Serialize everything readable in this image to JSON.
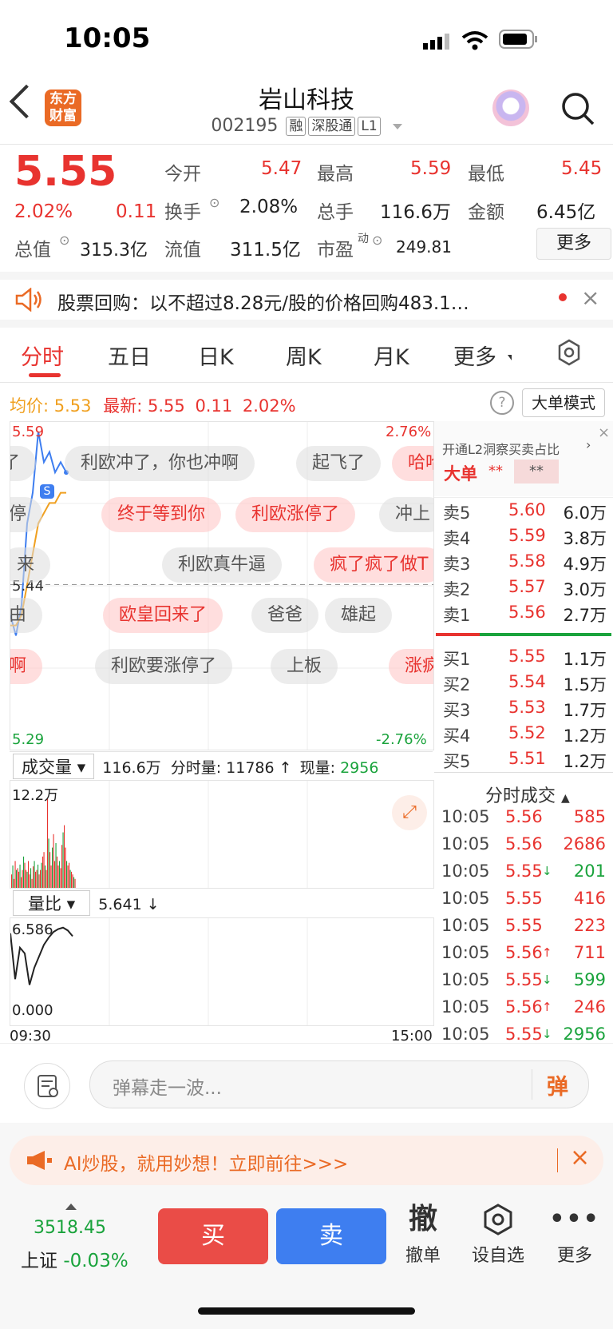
{
  "status_bar": {
    "time": "10:05"
  },
  "header": {
    "logo_text": "东方财富",
    "title": "岩山科技",
    "code": "002195",
    "tags": [
      "融",
      "深股通",
      "L1"
    ]
  },
  "quote": {
    "price": "5.55",
    "change_pct": "2.02%",
    "change": "0.11",
    "open_label": "今开",
    "open": "5.47",
    "high_label": "最高",
    "high": "5.59",
    "low_label": "最低",
    "low": "5.45",
    "turnover_label": "换手",
    "turnover": "2.08%",
    "volume_label": "总手",
    "volume": "116.6万",
    "amount_label": "金额",
    "amount": "6.45亿",
    "mktcap_label": "总值",
    "mktcap": "315.3亿",
    "float_label": "流值",
    "float": "311.5亿",
    "pe_label": "市盈",
    "pe_sup": "动",
    "pe": "249.81",
    "more_button": "更多"
  },
  "notice": {
    "text": "股票回购：以不超过8.28元/股的价格回购483.1…"
  },
  "tabs": [
    "分时",
    "五日",
    "日K",
    "周K",
    "月K",
    "更多"
  ],
  "info_line": {
    "avg_label": "均价:",
    "avg": "5.53",
    "latest_label": "最新:",
    "latest": "5.55",
    "latest_change": "0.11",
    "latest_pct": "2.02%",
    "mode_button": "大单模式"
  },
  "chart_data": {
    "type": "line",
    "ylabels_left": [
      "5.59",
      "5.44",
      "5.29"
    ],
    "ylabels_right": [
      "2.76%",
      "-2.76%"
    ],
    "xlabels": [
      "09:30",
      "15:00"
    ],
    "price_ref": 5.44,
    "series": [
      {
        "name": "最新",
        "color": "#3e7ef0",
        "values": [
          5.41,
          5.39,
          5.42,
          5.5,
          5.53,
          5.59,
          5.56,
          5.57,
          5.55,
          5.56,
          5.55
        ]
      },
      {
        "name": "均价",
        "color": "#f0a020",
        "values": [
          5.4,
          5.4,
          5.41,
          5.44,
          5.47,
          5.5,
          5.51,
          5.52,
          5.52,
          5.53,
          5.53
        ]
      }
    ]
  },
  "danmu": [
    {
      "text": "了",
      "style": "g"
    },
    {
      "text": "利欧冲了，你也冲啊",
      "style": "g"
    },
    {
      "text": "起飞了",
      "style": "g"
    },
    {
      "text": "哈哈",
      "style": "r"
    },
    {
      "text": "停",
      "style": "g"
    },
    {
      "text": "终于等到你",
      "style": "r"
    },
    {
      "text": "利欧涨停了",
      "style": "r"
    },
    {
      "text": "冲上",
      "style": "g"
    },
    {
      "text": "来",
      "style": "g"
    },
    {
      "text": "利欧真牛逼",
      "style": "g"
    },
    {
      "text": "疯了疯了做T",
      "style": "r"
    },
    {
      "text": "由",
      "style": "g"
    },
    {
      "text": "欧皇回来了",
      "style": "r"
    },
    {
      "text": "爸爸",
      "style": "g"
    },
    {
      "text": "雄起",
      "style": "g"
    },
    {
      "text": "啊",
      "style": "r"
    },
    {
      "text": "利欧要涨停了",
      "style": "g"
    },
    {
      "text": "上板",
      "style": "g"
    },
    {
      "text": "涨疯",
      "style": "r"
    }
  ],
  "volume_panel": {
    "selector": "成交量",
    "total": "116.6万",
    "tick_label": "分时量:",
    "tick": "11786",
    "now_label": "现量:",
    "now": "2956",
    "ymax": "12.2万",
    "bars": [
      0.15,
      0.25,
      0.1,
      0.3,
      0.2,
      0.22,
      0.18,
      0.26,
      0.12,
      0.2,
      0.35,
      0.28,
      0.2,
      0.18,
      0.3,
      0.15,
      0.22,
      0.1,
      0.24,
      0.3,
      0.18,
      0.2,
      0.26,
      0.15,
      0.2,
      0.28,
      0.35,
      0.4,
      0.25,
      0.2,
      1.0,
      0.55,
      0.4,
      0.25,
      0.45,
      0.6,
      0.3,
      0.5,
      0.35,
      0.25,
      0.3,
      0.22,
      0.48,
      0.62,
      0.7,
      0.45,
      0.3,
      0.25,
      0.28,
      0.2,
      0.18,
      0.15,
      0.12,
      0.1
    ]
  },
  "ratio_panel": {
    "selector": "量比",
    "value": "5.641",
    "ymax": "6.586",
    "ymin": "0.000",
    "values": [
      6.2,
      3.0,
      5.2,
      4.8,
      2.6,
      3.8,
      4.6,
      5.4,
      5.9,
      6.3,
      6.5,
      6.6,
      6.4,
      6.0
    ]
  },
  "orderbook": {
    "banner": "开通L2洞察买卖占比",
    "big_label": "大单",
    "big_value": "**",
    "big_value2": "**",
    "asks": [
      {
        "label": "卖5",
        "price": "5.60",
        "vol": "6.0万"
      },
      {
        "label": "卖4",
        "price": "5.59",
        "vol": "3.8万"
      },
      {
        "label": "卖3",
        "price": "5.58",
        "vol": "4.9万"
      },
      {
        "label": "卖2",
        "price": "5.57",
        "vol": "3.0万"
      },
      {
        "label": "卖1",
        "price": "5.56",
        "vol": "2.7万"
      }
    ],
    "bids": [
      {
        "label": "买1",
        "price": "5.55",
        "vol": "1.1万"
      },
      {
        "label": "买2",
        "price": "5.54",
        "vol": "1.5万"
      },
      {
        "label": "买3",
        "price": "5.53",
        "vol": "1.7万"
      },
      {
        "label": "买4",
        "price": "5.52",
        "vol": "1.2万"
      },
      {
        "label": "买5",
        "price": "5.51",
        "vol": "1.2万"
      }
    ]
  },
  "ticks": {
    "header": "分时成交",
    "rows": [
      {
        "time": "10:05",
        "price": "5.56",
        "arrow": "",
        "vol": "585",
        "color": "red"
      },
      {
        "time": "10:05",
        "price": "5.56",
        "arrow": "",
        "vol": "2686",
        "color": "red"
      },
      {
        "time": "10:05",
        "price": "5.55",
        "arrow": "↓",
        "vol": "201",
        "color": "green"
      },
      {
        "time": "10:05",
        "price": "5.55",
        "arrow": "",
        "vol": "416",
        "color": "red"
      },
      {
        "time": "10:05",
        "price": "5.55",
        "arrow": "",
        "vol": "223",
        "color": "red"
      },
      {
        "time": "10:05",
        "price": "5.56",
        "arrow": "↑",
        "vol": "711",
        "color": "red"
      },
      {
        "time": "10:05",
        "price": "5.55",
        "arrow": "↓",
        "vol": "599",
        "color": "green"
      },
      {
        "time": "10:05",
        "price": "5.56",
        "arrow": "↑",
        "vol": "246",
        "color": "red"
      },
      {
        "time": "10:05",
        "price": "5.55",
        "arrow": "↓",
        "vol": "2956",
        "color": "green"
      }
    ]
  },
  "comment": {
    "placeholder": "弹幕走一波...",
    "send": "弹"
  },
  "ad": {
    "text": "AI炒股，就用妙想！立即前往>>>"
  },
  "bottom": {
    "index_value": "3518.45",
    "index_name": "上证",
    "index_change": "-0.03%",
    "buy": "买",
    "sell": "卖",
    "cancel_icon": "撤",
    "cancel_label": "撤单",
    "watch_label": "设自选",
    "more_label": "更多"
  },
  "colors": {
    "up": "#e8332f",
    "down": "#1aa33c",
    "accent": "#3e7ef0"
  }
}
